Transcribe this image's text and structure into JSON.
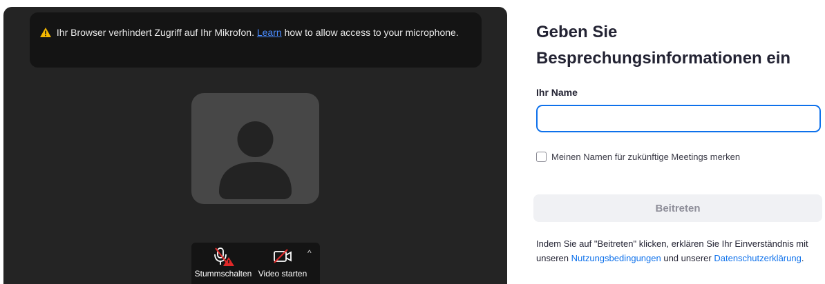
{
  "banner": {
    "icon": "warning-icon",
    "text_before": "Ihr Browser verhindert Zugriff auf Ihr Mikrofon.",
    "link": "Learn",
    "text_after": "how to allow access to your microphone."
  },
  "avatar": {
    "icon": "user-placeholder-icon"
  },
  "controls": {
    "mute_label": "Stummschalten",
    "video_label": "Video starten",
    "caret": "^"
  },
  "form": {
    "title_line1": "Geben Sie",
    "title_line2": "Besprechungsinformationen ein",
    "name_label": "Ihr Name",
    "name_value": "",
    "remember_label": "Meinen Namen für zukünftige Meetings merken",
    "remember_checked": false,
    "join_label": "Beitreten",
    "terms_before": "Indem Sie auf \"Beitreten\" klicken, erklären Sie Ihr Einverständnis mit unseren",
    "terms_link1": "Nutzungsbedingungen",
    "terms_middle": "und unserer",
    "terms_link2": "Datenschutzerklärung",
    "terms_end": "."
  },
  "colors": {
    "accent": "#0e71eb",
    "warning": "#f5b800",
    "muted_red": "#e02828",
    "panel_bg": "#242424"
  }
}
